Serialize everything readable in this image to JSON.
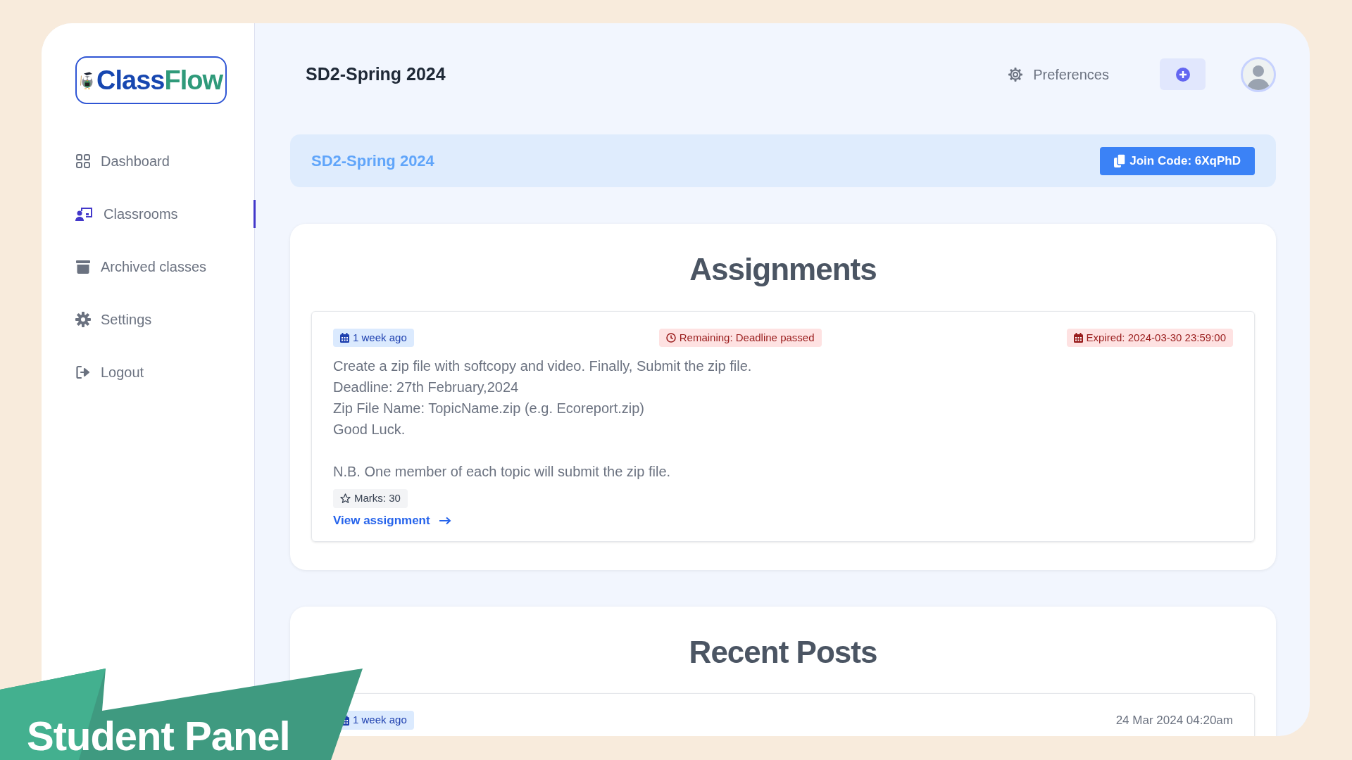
{
  "logo": {
    "first": "Class",
    "second": "Flow"
  },
  "sidebar": {
    "items": [
      {
        "label": "Dashboard",
        "kind": "grid",
        "selected": false
      },
      {
        "label": "Classrooms",
        "kind": "classroom",
        "selected": true
      },
      {
        "label": "Archived classes",
        "kind": "archive",
        "selected": false
      },
      {
        "label": "Settings",
        "kind": "gear",
        "selected": false
      },
      {
        "label": "Logout",
        "kind": "logout",
        "selected": false
      }
    ]
  },
  "header": {
    "title": "SD2-Spring 2024",
    "preferences": "Preferences"
  },
  "class_banner": {
    "title": "SD2-Spring 2024",
    "join_code": "Join Code: 6XqPhD"
  },
  "assignments": {
    "heading": "Assignments",
    "items": [
      {
        "posted": "1 week ago",
        "remaining": "Remaining: Deadline passed",
        "expired": "Expired: 2024-03-30 23:59:00",
        "paragraphs": [
          "Create a zip file with softcopy and video. Finally, Submit the zip file.\nDeadline: 27th February,2024\nZip File Name: TopicName.zip (e.g. Ecoreport.zip)\nGood Luck.",
          "N.B. One member of each topic will submit the zip file."
        ],
        "marks": "Marks: 30",
        "link": "View assignment"
      }
    ]
  },
  "recent_posts": {
    "heading": "Recent Posts",
    "items": [
      {
        "posted": "1 week ago",
        "date": "24 Mar 2024 04:20am"
      }
    ]
  },
  "promo_banner": {
    "label": "Student Panel"
  }
}
